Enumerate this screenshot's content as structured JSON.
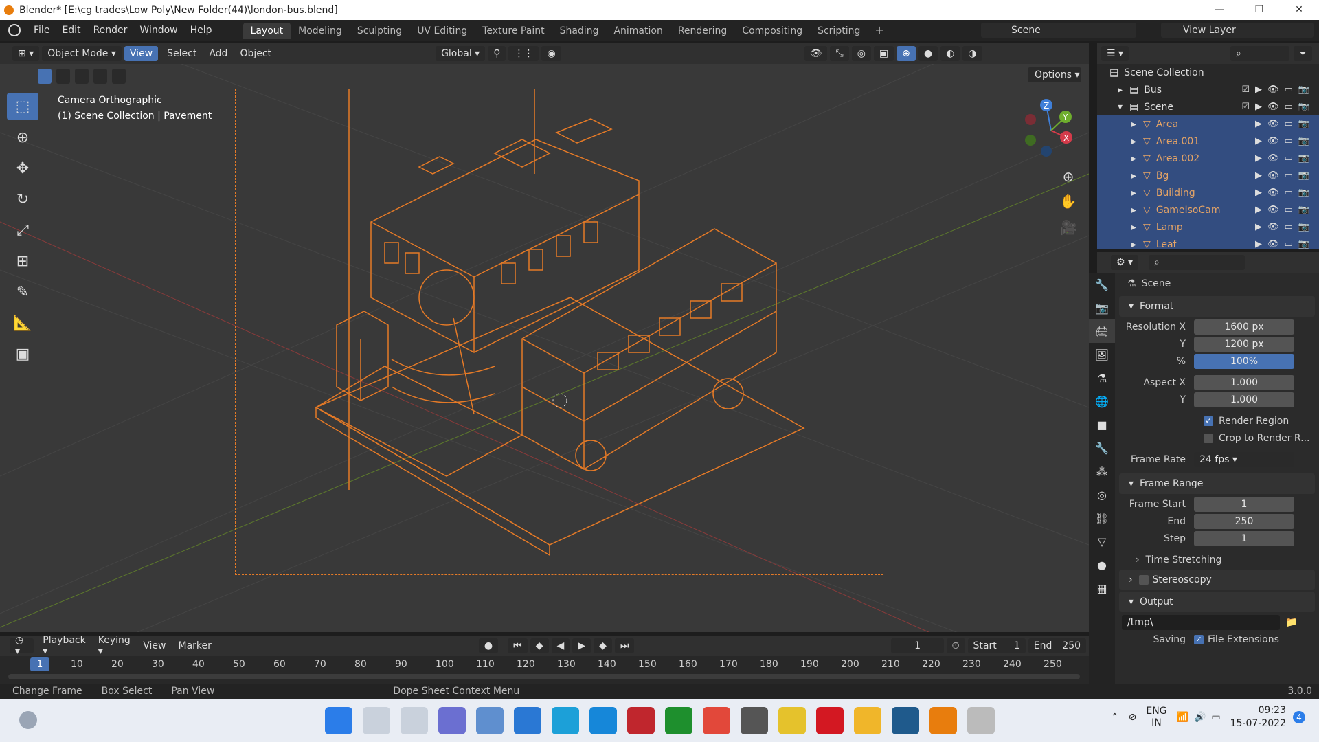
{
  "window": {
    "title": "Blender* [E:\\cg trades\\Low Poly\\New Folder(44)\\london-bus.blend]",
    "minimize": "—",
    "maximize": "❐",
    "close": "✕"
  },
  "menu": [
    "File",
    "Edit",
    "Render",
    "Window",
    "Help"
  ],
  "workspaces": [
    "Layout",
    "Modeling",
    "Sculpting",
    "UV Editing",
    "Texture Paint",
    "Shading",
    "Animation",
    "Rendering",
    "Compositing",
    "Scripting"
  ],
  "scene_name": "Scene",
  "view_layer": "View Layer",
  "viewport_header": {
    "mode": "Object Mode",
    "view": "View",
    "select": "Select",
    "add": "Add",
    "object": "Object",
    "orientation": "Global"
  },
  "viewport": {
    "camera_info": "Camera Orthographic",
    "collection_info": "(1) Scene Collection | Pavement",
    "options": "Options"
  },
  "gizmo": {
    "x": "X",
    "y": "Y",
    "z": "Z"
  },
  "outliner": {
    "root": "Scene Collection",
    "collections": [
      {
        "name": "Bus"
      },
      {
        "name": "Scene"
      }
    ],
    "objects": [
      "Area",
      "Area.001",
      "Area.002",
      "Bg",
      "Building",
      "GameIsoCam",
      "Lamp",
      "Leaf"
    ]
  },
  "properties": {
    "title": "Scene",
    "format_label": "Format",
    "resolution_x_label": "Resolution X",
    "resolution_x": "1600 px",
    "resolution_y_label": "Y",
    "resolution_y": "1200 px",
    "percent_label": "%",
    "percent": "100%",
    "aspect_x_label": "Aspect X",
    "aspect_x": "1.000",
    "aspect_y_label": "Y",
    "aspect_y": "1.000",
    "render_region": "Render Region",
    "crop_region": "Crop to Render R...",
    "frame_rate_label": "Frame Rate",
    "frame_rate": "24 fps",
    "frame_range_label": "Frame Range",
    "frame_start_label": "Frame Start",
    "frame_start": "1",
    "end_label": "End",
    "end": "250",
    "step_label": "Step",
    "step": "1",
    "time_stretching": "Time Stretching",
    "stereoscopy": "Stereoscopy",
    "output_label": "Output",
    "output_path": "/tmp\\",
    "saving_label": "Saving",
    "file_extensions": "File Extensions"
  },
  "timeline_header": {
    "playback": "Playback",
    "keying": "Keying",
    "view": "View",
    "marker": "Marker",
    "current": "1",
    "start_label": "Start",
    "start": "1",
    "end_label": "End",
    "end": "250"
  },
  "timeline_ticks": [
    "1",
    "10",
    "20",
    "30",
    "40",
    "50",
    "60",
    "70",
    "80",
    "90",
    "100",
    "110",
    "120",
    "130",
    "140",
    "150",
    "160",
    "170",
    "180",
    "190",
    "200",
    "210",
    "220",
    "230",
    "240",
    "250"
  ],
  "status": {
    "change_frame": "Change Frame",
    "box_select": "Box Select",
    "pan_view": "Pan View",
    "context_menu": "Dope Sheet Context Menu",
    "version": "3.0.0"
  },
  "taskbar": {
    "lang": "ENG",
    "region": "IN",
    "time": "09:23",
    "date": "15-07-2022",
    "notif": "4"
  },
  "colors": {
    "accent": "#4772b3",
    "wire": "#e57a27",
    "selected_row": "#334d80"
  }
}
